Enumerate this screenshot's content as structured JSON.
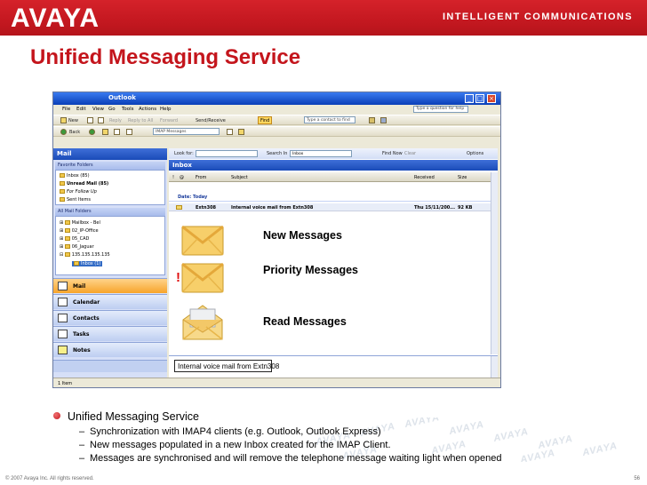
{
  "header": {
    "logo": "AVAYA",
    "tagline": "INTELLIGENT COMMUNICATIONS",
    "brand_color": "#c4151c"
  },
  "slide_title": "Unified Messaging Service",
  "outlook": {
    "window_title": "Outlook",
    "menu": [
      "File",
      "Edit",
      "View",
      "Go",
      "Tools",
      "Actions",
      "Help"
    ],
    "help_placeholder": "Type a question for help",
    "toolbar1": {
      "new": "New",
      "reply": "Reply",
      "reply_all": "Reply to All",
      "forward": "Forward",
      "send_receive": "Send/Receive",
      "find": "Find",
      "contact_placeholder": "Type a contact to find"
    },
    "toolbar2": {
      "back": "Back",
      "folder_select": "IMAP Messages"
    },
    "nav": {
      "header": "Mail",
      "favorite_folders_label": "Favorite Folders",
      "favorites": [
        "Inbox (85)",
        "Unread Mail (85)",
        "For Follow Up",
        "Sent Items"
      ],
      "all_folders_label": "All Mail Folders",
      "folders": [
        "Mailbox - Bel",
        "02_IP-Office",
        "05_CAD",
        "06_Jaguar",
        "135.135.135.135",
        "Inbox (1)"
      ],
      "buttons": [
        "Mail",
        "Calendar",
        "Contacts",
        "Tasks",
        "Notes"
      ]
    },
    "find_bar": {
      "look_for_label": "Look for:",
      "search_in_label": "Search In",
      "search_in_value": "Inbox",
      "find_now": "Find Now",
      "clear": "Clear",
      "options": "Options"
    },
    "inbox_title": "Inbox",
    "columns": {
      "from": "From",
      "subject": "Subject",
      "received": "Received",
      "size": "Size"
    },
    "group_label": "Date: Today",
    "message": {
      "from": "Extn308",
      "subject": "Internal voice mail from Extn308",
      "received": "Thu 15/11/200...",
      "size": "92 KB"
    },
    "callouts": {
      "new": "New Messages",
      "priority": "Priority Messages",
      "read": "Read Messages",
      "priority_mark": "!"
    },
    "preview_subject": "Internal voice mail from Extn308",
    "status": "1 Item"
  },
  "watermark": "AVAYA",
  "bullets": {
    "main": "Unified Messaging Service",
    "subs": [
      "Synchronization with IMAP4 clients (e.g. Outlook, Outlook Express)",
      "New messages populated in a new Inbox created for the IMAP Client.",
      "Messages are synchronised and will remove the telephone message waiting light when opened"
    ]
  },
  "footer": {
    "copyright": "© 2007 Avaya Inc. All rights reserved.",
    "page": "56"
  }
}
